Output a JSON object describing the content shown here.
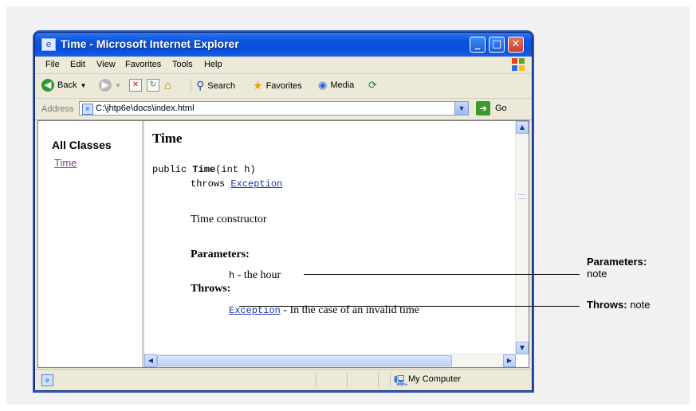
{
  "window": {
    "title": "Time - Microsoft Internet Explorer",
    "controls": [
      "minimize",
      "maximize",
      "close"
    ]
  },
  "menu": [
    "File",
    "Edit",
    "View",
    "Favorites",
    "Tools",
    "Help"
  ],
  "toolbar": {
    "back_label": "Back",
    "search_label": "Search",
    "favorites_label": "Favorites",
    "media_label": "Media"
  },
  "address": {
    "label": "Address",
    "value": "C:\\jhtp6e\\docs\\index.html",
    "go_label": "Go"
  },
  "left_frame": {
    "title": "All Classes",
    "link": "Time"
  },
  "doc": {
    "heading": "Time",
    "sig_public": "public ",
    "sig_name": "Time",
    "sig_params": "(int h)",
    "throws_kw": "throws ",
    "throws_link": "Exception",
    "description": "Time constructor",
    "params_label": "Parameters:",
    "param_name": "h",
    "param_desc": " - the hour",
    "throws_label": "Throws:",
    "exception_link": "Exception",
    "exception_desc": " - In the case of an invalid time"
  },
  "status": {
    "zone": "My Computer"
  },
  "callouts": {
    "parameters_bold": "Parameters:",
    "parameters_text": "note",
    "throws_bold": "Throws:",
    "throws_text": "note"
  }
}
